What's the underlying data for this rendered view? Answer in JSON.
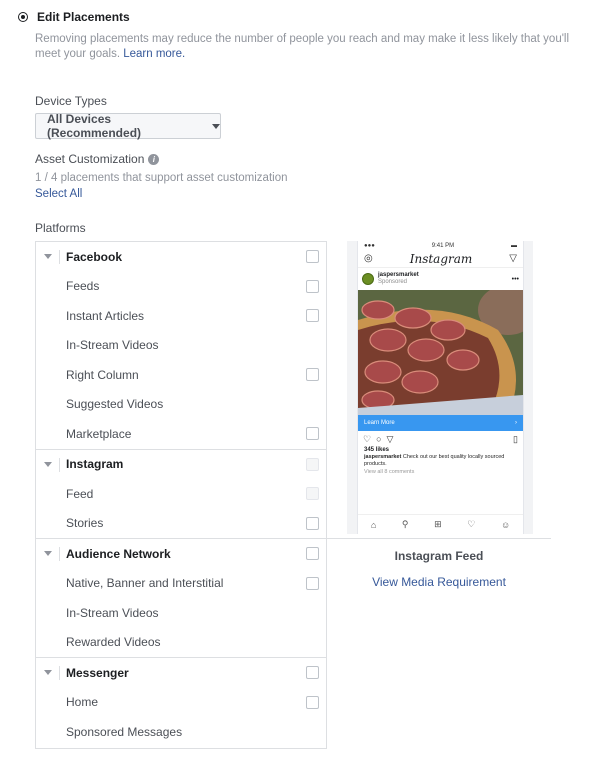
{
  "header": {
    "title": "Edit Placements",
    "description": "Removing placements may reduce the number of people you reach and may make it less likely that you'll meet your goals.",
    "learn_more": "Learn more."
  },
  "device_types": {
    "label": "Device Types",
    "selected": "All Devices (Recommended)"
  },
  "asset_customization": {
    "label": "Asset Customization",
    "info_icon": "i",
    "summary": "1 / 4 placements that support asset customization",
    "select_all": "Select All"
  },
  "platforms": {
    "label": "Platforms",
    "groups": [
      {
        "name": "Facebook",
        "items": [
          "Feeds",
          "Instant Articles",
          "In-Stream Videos",
          "Right Column",
          "Suggested Videos",
          "Marketplace"
        ]
      },
      {
        "name": "Instagram",
        "items": [
          "Feed",
          "Stories"
        ]
      },
      {
        "name": "Audience Network",
        "items": [
          "Native, Banner and Interstitial",
          "In-Stream Videos",
          "Rewarded Videos"
        ]
      },
      {
        "name": "Messenger",
        "items": [
          "Home",
          "Sponsored Messages"
        ]
      }
    ]
  },
  "preview": {
    "status_time": "9:41 PM",
    "app_name": "Instagram",
    "account": "jaspersmarket",
    "sponsored": "Sponsored",
    "cta": "Learn More",
    "likes": "345 likes",
    "caption_user": "jaspersmarket",
    "caption_text": "Check out our best quality locally sourced products.",
    "view_comments": "View all 8 comments",
    "title": "Instagram Feed",
    "link": "View Media Requirement"
  }
}
